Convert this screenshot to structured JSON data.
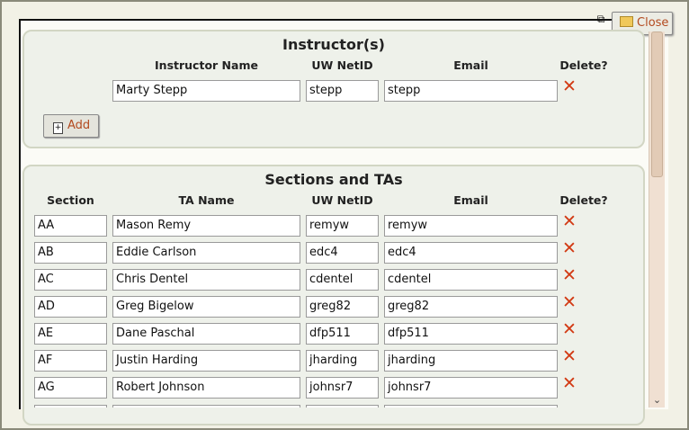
{
  "window": {
    "close_label": "Close"
  },
  "instructors": {
    "title": "Instructor(s)",
    "headers": {
      "name": "Instructor Name",
      "netid": "UW NetID",
      "email": "Email",
      "delete": "Delete?"
    },
    "rows": [
      {
        "name": "Marty Stepp",
        "netid": "stepp",
        "email": "stepp"
      }
    ],
    "add_label": "Add"
  },
  "sections": {
    "title": "Sections and TAs",
    "headers": {
      "section": "Section",
      "name": "TA Name",
      "netid": "UW NetID",
      "email": "Email",
      "delete": "Delete?"
    },
    "rows": [
      {
        "section": "AA",
        "name": "Mason Remy",
        "netid": "remyw",
        "email": "remyw"
      },
      {
        "section": "AB",
        "name": "Eddie Carlson",
        "netid": "edc4",
        "email": "edc4"
      },
      {
        "section": "AC",
        "name": "Chris Dentel",
        "netid": "cdentel",
        "email": "cdentel"
      },
      {
        "section": "AD",
        "name": "Greg Bigelow",
        "netid": "greg82",
        "email": "greg82"
      },
      {
        "section": "AE",
        "name": "Dane Paschal",
        "netid": "dfp511",
        "email": "dfp511"
      },
      {
        "section": "AF",
        "name": "Justin Harding",
        "netid": "jharding",
        "email": "jharding"
      },
      {
        "section": "AG",
        "name": "Robert Johnson",
        "netid": "johnsr7",
        "email": "johnsr7"
      }
    ]
  },
  "icons": {
    "delete": "delete-x-icon",
    "close": "folder-icon",
    "add": "add-page-icon",
    "restore": "restore-icon"
  },
  "colors": {
    "accent": "#b34a1f",
    "delete": "#d23a14",
    "panel_bg": "#eef1ea"
  }
}
